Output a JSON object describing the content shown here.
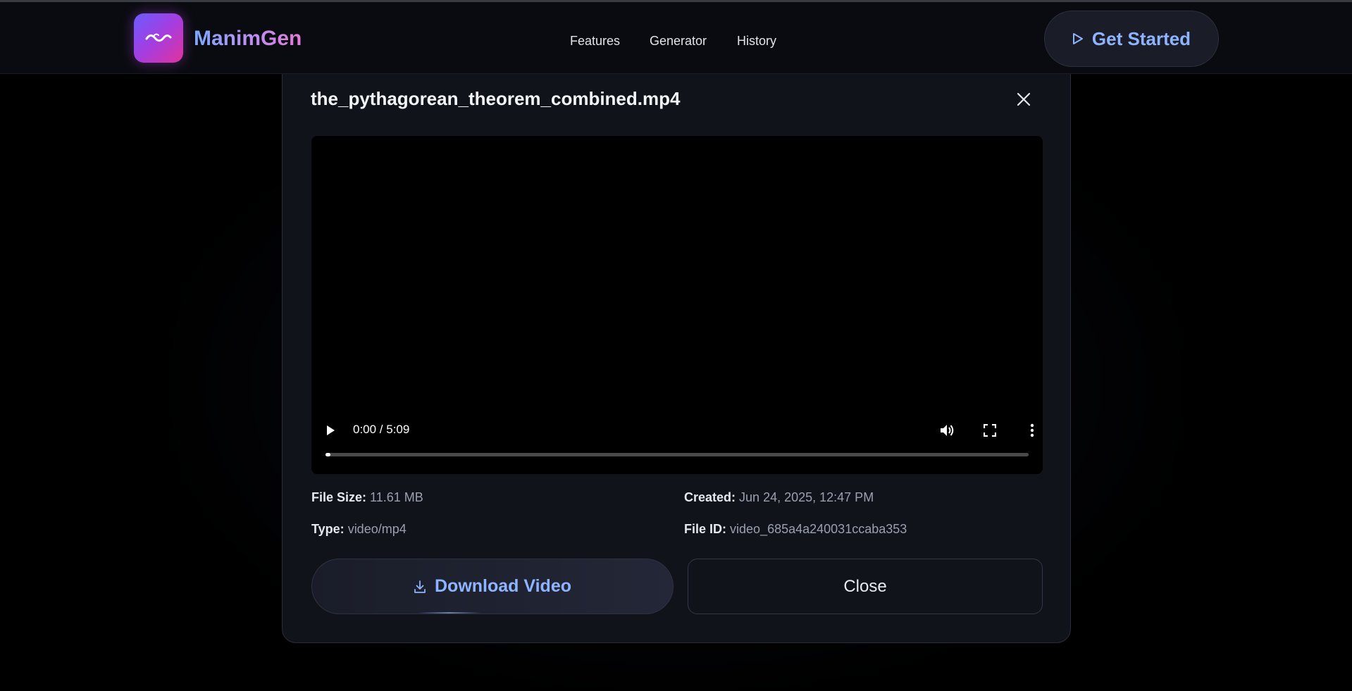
{
  "header": {
    "brand": "ManimGen",
    "nav": [
      "Features",
      "Generator",
      "History"
    ],
    "cta_label": "Get Started"
  },
  "modal": {
    "title": "the_pythagorean_theorem_combined.mp4",
    "player": {
      "time": "0:00 / 5:09",
      "progress_fraction": 0.0
    },
    "info": {
      "size_label": "File Size:",
      "size_value": "11.61 MB",
      "created_label": "Created:",
      "created_value": "Jun 24, 2025, 12:47 PM",
      "type_label": "Type:",
      "type_value": "video/mp4",
      "id_label": "File ID:",
      "id_value": "video_685a4a240031ccaba353"
    },
    "download_label": "Download Video",
    "close_label": "Close"
  },
  "colors": {
    "accent": "#8fb4ff",
    "brand_gradient_start": "#6a5cff",
    "brand_gradient_end": "#e2339a",
    "modal_bg": "#11131b"
  },
  "icons": {
    "logo": "wave-icon",
    "cta": "play-outline-icon",
    "modal_close": "close-icon",
    "download": "download-icon"
  }
}
